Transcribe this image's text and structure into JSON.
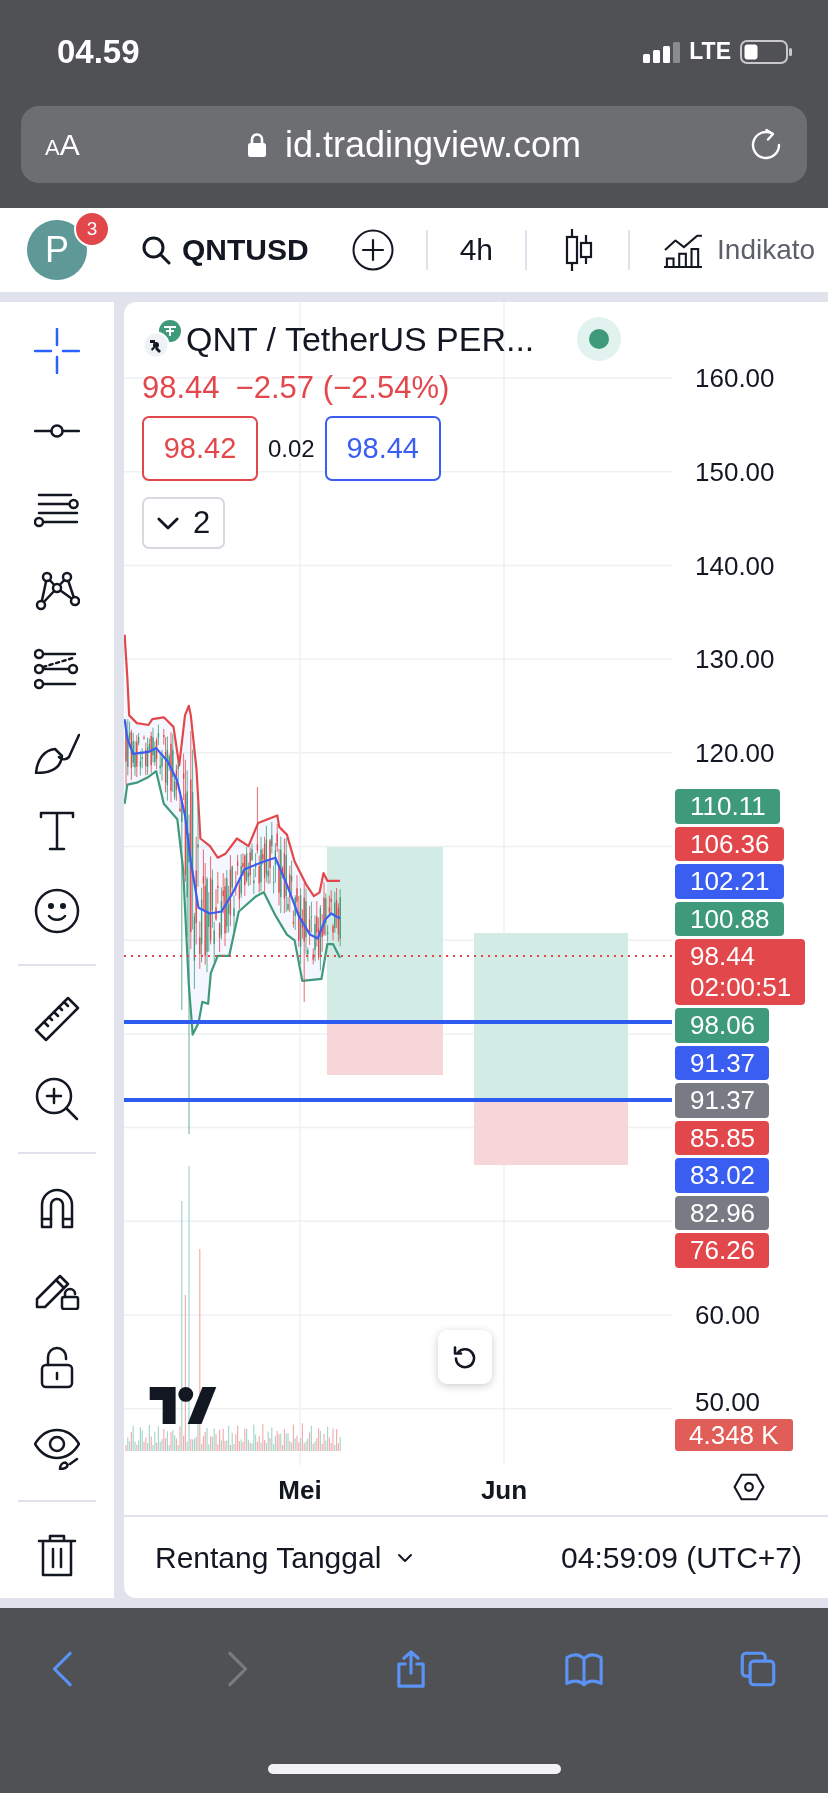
{
  "status_bar": {
    "time": "04.59",
    "network": "LTE"
  },
  "address_bar": {
    "text_size_button": "AA",
    "url": "id.tradingview.com"
  },
  "toolbar": {
    "avatar_letter": "P",
    "notification_count": "3",
    "symbol": "QNTUSD",
    "interval": "4h",
    "indicators_label": "Indikato"
  },
  "tool_groups": [
    [
      {
        "kind": "crosshair",
        "selected": true
      },
      {
        "kind": "horizontal-line",
        "selected": false
      },
      {
        "kind": "fibonacci",
        "selected": false
      },
      {
        "kind": "pattern",
        "selected": false
      },
      {
        "kind": "prediction",
        "selected": false
      },
      {
        "kind": "brush",
        "selected": false
      },
      {
        "kind": "text",
        "selected": false
      },
      {
        "kind": "emoji",
        "selected": false
      }
    ],
    [
      {
        "kind": "ruler",
        "selected": false
      },
      {
        "kind": "zoom-in",
        "selected": false
      }
    ],
    [
      {
        "kind": "magnet",
        "selected": false
      },
      {
        "kind": "drawing-lock",
        "selected": false
      },
      {
        "kind": "lock",
        "selected": false
      },
      {
        "kind": "visibility",
        "selected": false
      }
    ],
    [
      {
        "kind": "trash",
        "selected": false
      }
    ]
  ],
  "legend": {
    "title": "QNT / TetherUS PER...",
    "last_price": "98.44",
    "change": "−2.57 (−2.54%)",
    "sell_price": "98.42",
    "spread": "0.02",
    "buy_price": "98.44",
    "indicator_count": "2"
  },
  "price_axis": [
    "160.00",
    "150.00",
    "140.00",
    "130.00",
    "120.00",
    "60.00",
    "50.00"
  ],
  "price_badges": [
    {
      "text": "110.11",
      "color": "#3f9a7c"
    },
    {
      "text": "106.36",
      "color": "#e2474b"
    },
    {
      "text": "102.21",
      "color": "#3a5ef2"
    },
    {
      "text": "100.88",
      "color": "#3f9a7c"
    },
    {
      "text": "98.44",
      "countdown": "02:00:51",
      "color": "#e2474b"
    },
    {
      "text": "98.06",
      "color": "#3f9a7c"
    },
    {
      "text": "91.37",
      "color": "#3a5ef2"
    },
    {
      "text": "91.37",
      "color": "#797b84"
    },
    {
      "text": "85.85",
      "color": "#e2474b"
    },
    {
      "text": "83.02",
      "color": "#3a5ef2"
    },
    {
      "text": "82.96",
      "color": "#797b84"
    },
    {
      "text": "76.26",
      "color": "#e2474b"
    }
  ],
  "volume_badge": "4.348 K",
  "time_axis": [
    "Mei",
    "Jun"
  ],
  "footer": {
    "date_range": "Rentang Tanggal",
    "clock": "04:59:09 (UTC+7)"
  },
  "browser_toolbar": [
    {
      "kind": "back",
      "disabled": false
    },
    {
      "kind": "forward",
      "disabled": true
    },
    {
      "kind": "share",
      "disabled": false
    },
    {
      "kind": "bookmarks",
      "disabled": false
    },
    {
      "kind": "tabs",
      "disabled": false
    }
  ]
}
